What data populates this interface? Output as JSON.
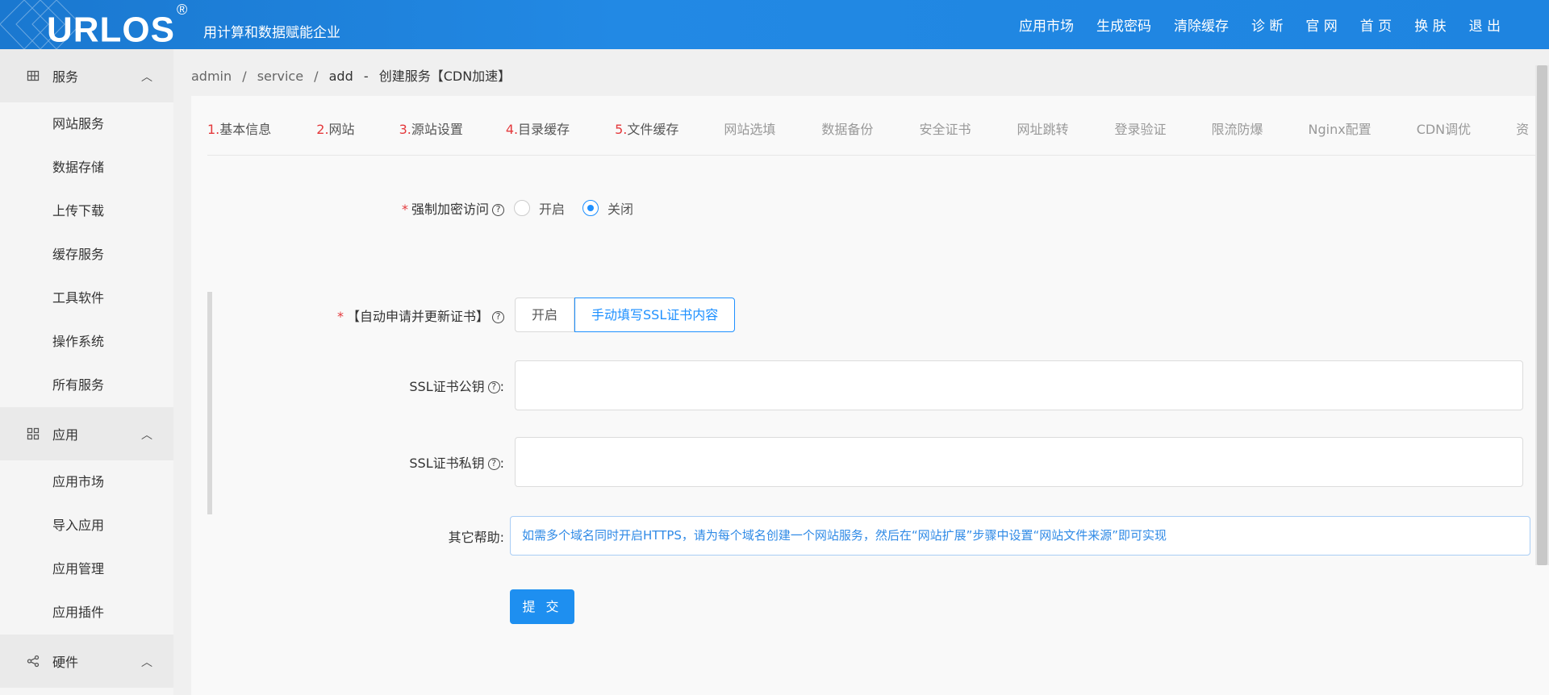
{
  "header": {
    "logo": "URLOS",
    "logo_mark": "®",
    "slogan": "用计算和数据赋能企业",
    "nav": [
      "应用市场",
      "生成密码",
      "清除缓存",
      "诊 断",
      "官 网",
      "首 页",
      "换 肤",
      "退 出"
    ]
  },
  "sidebar": {
    "groups": [
      {
        "label": "服务",
        "icon": "grid-icon",
        "items": [
          "网站服务",
          "数据存储",
          "上传下载",
          "缓存服务",
          "工具软件",
          "操作系统",
          "所有服务"
        ]
      },
      {
        "label": "应用",
        "icon": "apps-icon",
        "items": [
          "应用市场",
          "导入应用",
          "应用管理",
          "应用插件"
        ]
      },
      {
        "label": "硬件",
        "icon": "share-icon",
        "items": []
      }
    ]
  },
  "breadcrumb": [
    "admin",
    "/",
    "service",
    "/",
    "add",
    "-",
    "创建服务【CDN加速】"
  ],
  "tabs": [
    {
      "num": "1.",
      "label": "基本信息"
    },
    {
      "num": "2.",
      "label": "网站"
    },
    {
      "num": "3.",
      "label": "源站设置"
    },
    {
      "num": "4.",
      "label": "目录缓存"
    },
    {
      "num": "5.",
      "label": "文件缓存"
    },
    {
      "num": "",
      "label": "网站选填"
    },
    {
      "num": "",
      "label": "数据备份"
    },
    {
      "num": "",
      "label": "安全证书"
    },
    {
      "num": "",
      "label": "网址跳转"
    },
    {
      "num": "",
      "label": "登录验证"
    },
    {
      "num": "",
      "label": "限流防爆"
    },
    {
      "num": "",
      "label": "Nginx配置"
    },
    {
      "num": "",
      "label": "CDN调优"
    },
    {
      "num": "",
      "label": "资"
    }
  ],
  "form": {
    "force_https": {
      "label": "强制加密访问",
      "options": [
        "开启",
        "关闭"
      ],
      "selected": "关闭"
    },
    "auto_cert": {
      "label": "【自动申请并更新证书】",
      "options": [
        "开启",
        "手动填写SSL证书内容"
      ],
      "selected": "手动填写SSL证书内容"
    },
    "ssl_public": {
      "label": "SSL证书公钥",
      "value": ""
    },
    "ssl_private": {
      "label": "SSL证书私钥",
      "value": ""
    },
    "other_help": {
      "label": "其它帮助:",
      "text": "如需多个域名同时开启HTTPS，请为每个域名创建一个网站服务，然后在“网站扩展”步骤中设置“网站文件来源”即可实现"
    },
    "submit": "提 交",
    "help_mark": "?",
    "colon": ":"
  }
}
